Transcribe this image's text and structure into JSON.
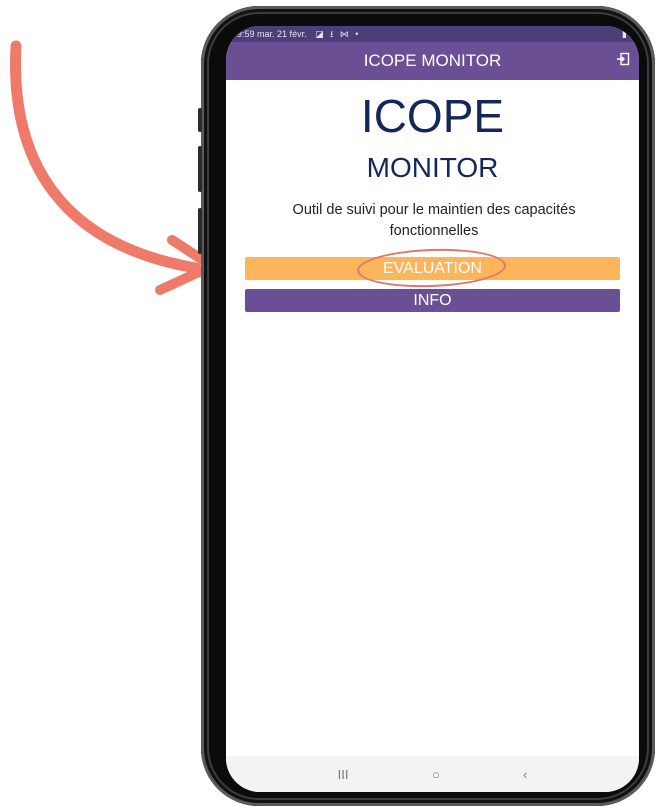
{
  "status_bar": {
    "time": "09:59",
    "date": "mar. 21 févr.",
    "icons": "◪ ⭳ ⋈ •"
  },
  "app_bar": {
    "title": "ICOPE MONITOR",
    "exit_icon": "exit-icon"
  },
  "main": {
    "title_line1": "ICOPE",
    "title_line2": "MONITOR",
    "subtitle": "Outil de suivi pour le maintien des capacités fonctionnelles",
    "evaluation_button": "EVALUATION",
    "info_button": "INFO"
  },
  "nav_bar": {
    "recent": "III",
    "home": "○",
    "back": "‹"
  },
  "colors": {
    "primary": "#6a4f95",
    "accent": "#fdb55c",
    "title": "#14275a",
    "annotation": "#e2766a"
  }
}
